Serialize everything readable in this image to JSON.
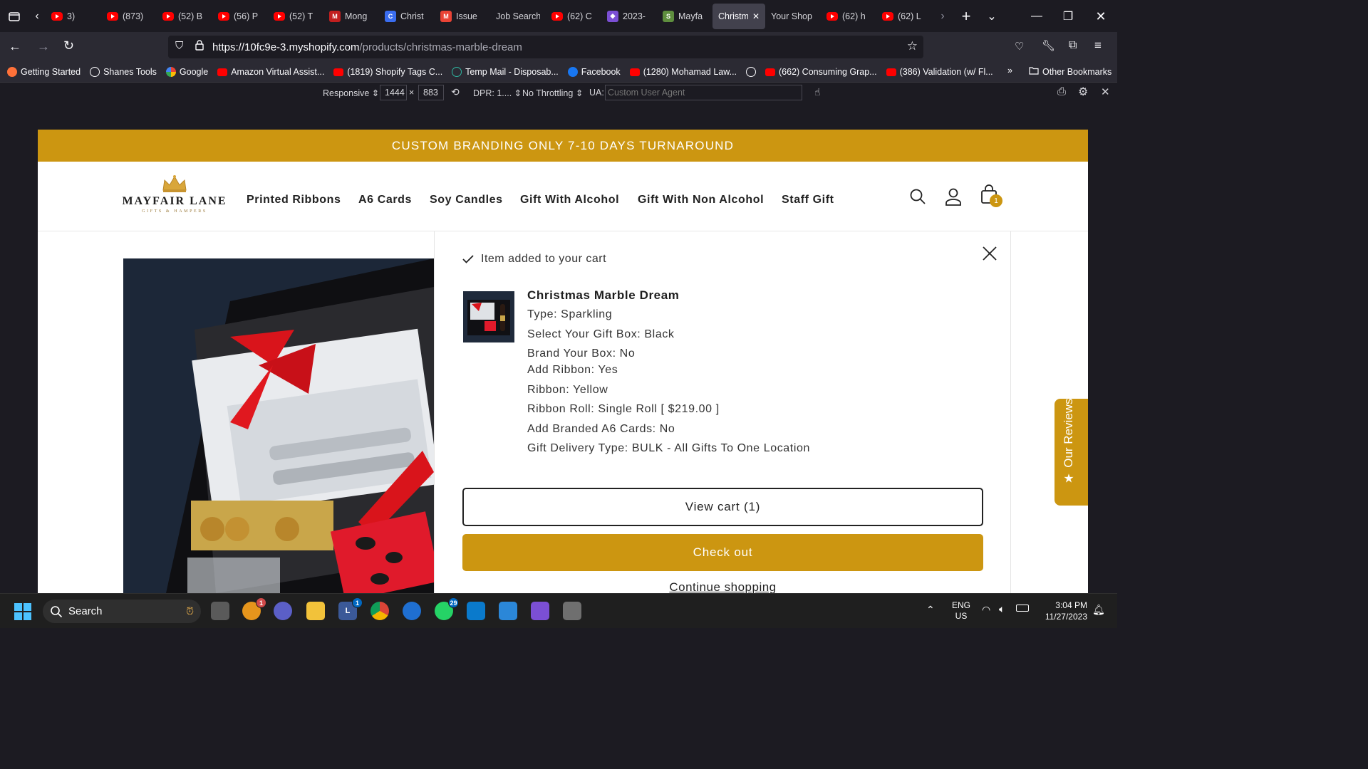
{
  "browser": {
    "tabs": [
      {
        "label": "3)",
        "favicon": "youtube"
      },
      {
        "label": "(873)",
        "favicon": "youtube"
      },
      {
        "label": "(52) B",
        "favicon": "youtube"
      },
      {
        "label": "(56) P",
        "favicon": "youtube"
      },
      {
        "label": "(52) T",
        "favicon": "youtube"
      },
      {
        "label": "Mong",
        "favicon": "mongo"
      },
      {
        "label": "Christ",
        "favicon": "canva"
      },
      {
        "label": "Issue",
        "favicon": "gmail"
      },
      {
        "label": "Job Search",
        "favicon": "none"
      },
      {
        "label": "(62) C",
        "favicon": "youtube"
      },
      {
        "label": "2023-",
        "favicon": "app"
      },
      {
        "label": "Mayfa",
        "favicon": "shopify"
      },
      {
        "label": "Christm",
        "favicon": "none",
        "active": true
      },
      {
        "label": "Your Shop",
        "favicon": "none"
      },
      {
        "label": "(62) h",
        "favicon": "youtube"
      },
      {
        "label": "(62) L",
        "favicon": "youtube"
      }
    ],
    "url_host": "https://10fc9e-3.myshopify.com",
    "url_path": "/products/christmas-marble-dream",
    "bookmarks": [
      {
        "label": "Getting Started",
        "icon": "firefox-icon"
      },
      {
        "label": "Shanes Tools",
        "icon": "globe-icon"
      },
      {
        "label": "Google",
        "icon": "google-icon"
      },
      {
        "label": "Amazon Virtual Assist...",
        "icon": "youtube-icon"
      },
      {
        "label": "(1819) Shopify Tags C...",
        "icon": "youtube-icon"
      },
      {
        "label": "Temp Mail - Disposab...",
        "icon": "tempmail-icon"
      },
      {
        "label": "Facebook",
        "icon": "facebook-icon"
      },
      {
        "label": "(1280) Mohamad Law...",
        "icon": "youtube-icon"
      },
      {
        "label": "",
        "icon": "globe-icon"
      },
      {
        "label": "(662) Consuming Grap...",
        "icon": "youtube-icon"
      },
      {
        "label": "(386) Validation (w/ Fl...",
        "icon": "youtube-icon"
      }
    ],
    "other_bookmarks": "Other Bookmarks"
  },
  "devtools": {
    "responsive": "Responsive",
    "width": "1444",
    "times": "×",
    "height": "883",
    "dpr": "DPR: 1....",
    "throttling": "No Throttling",
    "ua_label": "UA:",
    "ua_placeholder": "Custom User Agent"
  },
  "store": {
    "announcement": "CUSTOM BRANDING ONLY 7-10 DAYS TURNAROUND",
    "logo_name": "MAYFAIR LANE",
    "logo_tagline": "GIFTS & HAMPERS",
    "nav": [
      "Printed Ribbons",
      "A6 Cards",
      "Soy Candles",
      "Gift With Alcohol",
      "Gift With Non Alcohol",
      "Staff Gift"
    ],
    "cart_count": "1",
    "reviews_label": "Our Reviews",
    "accent": "#cc9611"
  },
  "cart_drawer": {
    "added_message": "Item added to your cart",
    "product_title": "Christmas Marble Dream",
    "options": [
      "Type: Sparkling",
      "Select Your Gift Box: Black",
      "Brand Your Box: No",
      "Add Ribbon: Yes",
      "Ribbon: Yellow",
      "Ribbon Roll: Single Roll [ $219.00 ]",
      "Add Branded A6 Cards: No",
      "Gift Delivery Type: BULK - All Gifts To One Location"
    ],
    "view_cart": "View cart (1)",
    "checkout": "Check out",
    "continue": "Continue shopping"
  },
  "taskbar": {
    "search": "Search",
    "lang_1": "ENG",
    "lang_2": "US",
    "time": "3:04 PM",
    "date": "11/27/2023",
    "badges": {
      "burger": "1",
      "teams": "1",
      "whatsapp": "29"
    }
  }
}
